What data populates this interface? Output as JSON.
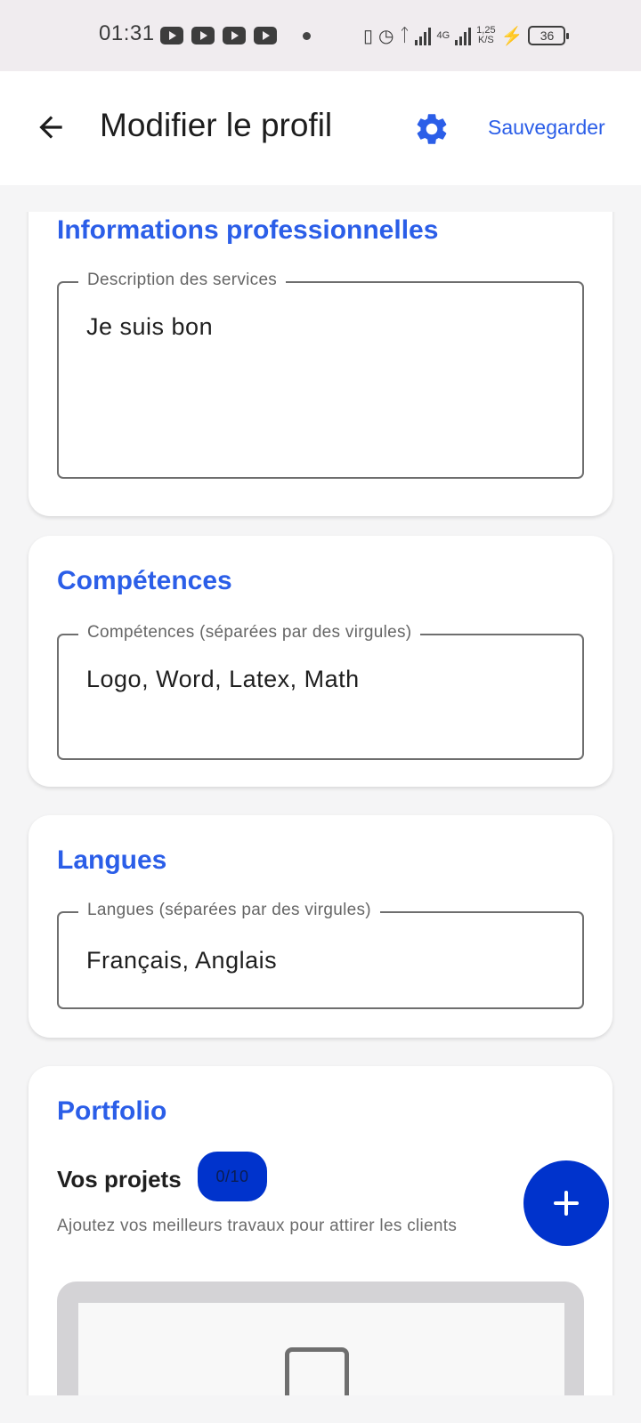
{
  "status_bar": {
    "time": "01:31",
    "network": "4G",
    "speed_value": "1,25",
    "speed_unit": "K/S",
    "battery": "36"
  },
  "app_bar": {
    "title": "Modifier le profil",
    "save_label": "Sauvegarder",
    "accent": "#2b5ee8"
  },
  "sections": {
    "professional": {
      "title": "Informations professionnelles",
      "description_label": "Description des services",
      "description_value": "Je suis bon"
    },
    "skills": {
      "title": "Compétences",
      "label": "Compétences (séparées par des virgules)",
      "value": "Logo, Word, Latex, Math"
    },
    "languages": {
      "title": "Langues",
      "label": "Langues (séparées par des virgules)",
      "value": "Français, Anglais"
    },
    "portfolio": {
      "title": "Portfolio",
      "projects_label": "Vos projets",
      "count": "0/10",
      "help": "Ajoutez vos meilleurs travaux pour attirer les clients",
      "fab_color": "#0033cc"
    }
  }
}
